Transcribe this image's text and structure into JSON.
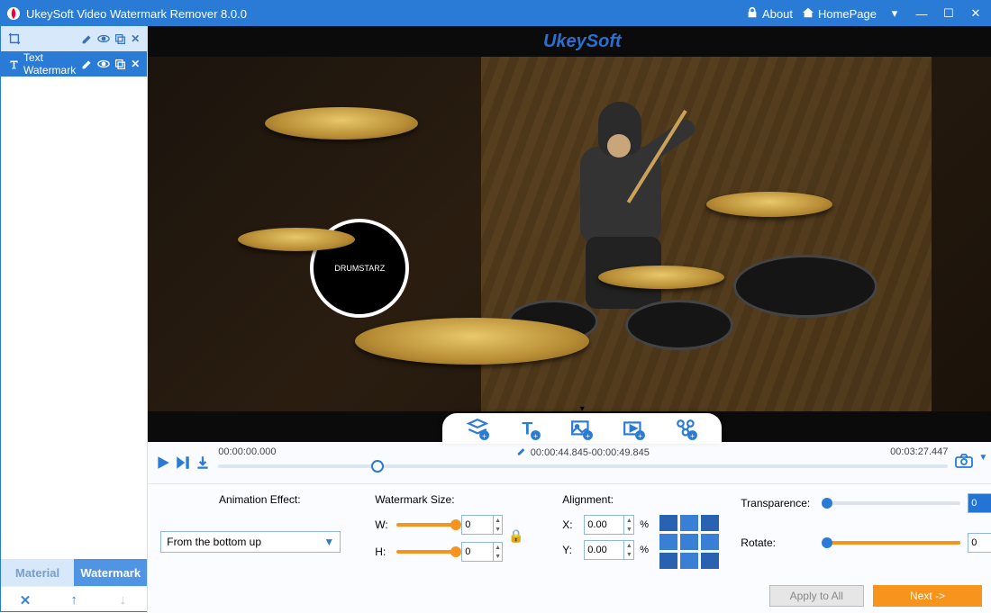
{
  "titlebar": {
    "title": "UkeySoft Video Watermark Remover 8.0.0",
    "about": "About",
    "homepage": "HomePage"
  },
  "sidebar": {
    "layer_text_watermark": "Text Watermark",
    "tabs": {
      "material": "Material",
      "watermark": "Watermark"
    }
  },
  "video": {
    "overlay_text": "UkeySoft",
    "badge_text": "DRUMSTARZ"
  },
  "timeline": {
    "start": "00:00:00.000",
    "mid": "00:00:44.845-00:00:49.845",
    "end": "00:03:27.447"
  },
  "controls": {
    "anim_label": "Animation Effect:",
    "anim_value": "From the bottom up",
    "size_label": "Watermark Size:",
    "w_label": "W:",
    "h_label": "H:",
    "w_value": "0",
    "h_value": "0",
    "align_label": "Alignment:",
    "x_label": "X:",
    "y_label": "Y:",
    "x_value": "0.00",
    "y_value": "0.00",
    "pct": "%",
    "transparence_label": "Transparence:",
    "rotate_label": "Rotate:",
    "transparence_value": "0",
    "rotate_value": "0"
  },
  "buttons": {
    "apply_all": "Apply to All",
    "next": "Next ->"
  }
}
